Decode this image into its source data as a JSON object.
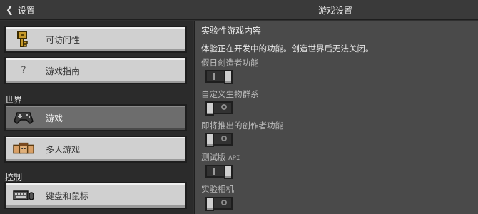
{
  "header": {
    "back_label": "设置",
    "title": "游戏设置"
  },
  "sidebar": {
    "items": [
      {
        "label": "可访问性",
        "icon": "key-icon"
      },
      {
        "label": "游戏指南",
        "icon": "question-icon"
      },
      {
        "label": "游戏",
        "icon": "controller-icon",
        "selected": true
      },
      {
        "label": "多人游戏",
        "icon": "players-icon"
      },
      {
        "label": "键盘和鼠标",
        "icon": "keyboard-icon"
      }
    ],
    "sections": {
      "world": "世界",
      "controls": "控制"
    },
    "question_glyph": "?"
  },
  "main": {
    "heading": "实验性游戏内容",
    "description": "体验正在开发中的功能。创造世界后无法关闭。",
    "options": [
      {
        "label": "假日创造者功能",
        "state": "on"
      },
      {
        "label": "自定义生物群系",
        "state": "off"
      },
      {
        "label": "即将推出的创作者功能",
        "state": "off"
      },
      {
        "label": "测试版",
        "label_suffix": "API",
        "state": "on"
      },
      {
        "label": "实验相机",
        "state": "off"
      }
    ]
  },
  "colors": {
    "panel_bg": "#4a4a4a",
    "button_bg": "#d0d0d0",
    "selected_bg": "#6d6d6d"
  }
}
